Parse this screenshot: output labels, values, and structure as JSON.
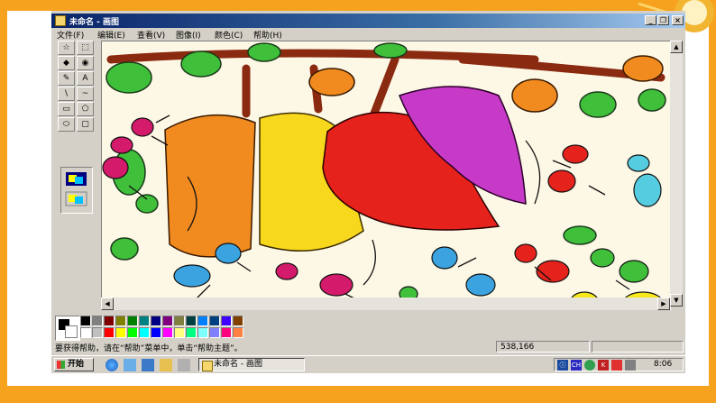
{
  "window": {
    "title": "未命名 - 画图"
  },
  "menu": [
    "文件(F)",
    "编辑(E)",
    "查看(V)",
    "图像(I)",
    "颜色(C)",
    "帮助(H)"
  ],
  "tools": [
    "☆",
    "⬚",
    "◆",
    "◉",
    "✎",
    "A",
    "\\",
    "~",
    "▭",
    "⬠",
    "⬭",
    "▢"
  ],
  "palette": [
    "#000000",
    "#808080",
    "#800000",
    "#808000",
    "#008000",
    "#008080",
    "#000080",
    "#800080",
    "#808040",
    "#004040",
    "#0080ff",
    "#004080",
    "#4000ff",
    "#804000",
    "#ffffff",
    "#c0c0c0",
    "#ff0000",
    "#ffff00",
    "#00ff00",
    "#00ffff",
    "#0000ff",
    "#ff00ff",
    "#ffff80",
    "#00ff80",
    "#80ffff",
    "#8080ff",
    "#ff0080",
    "#ff8040"
  ],
  "status": {
    "help": "要获得帮助，请在“帮助”菜单中，单击“帮助主题”。",
    "coords": "538,166"
  },
  "taskbar": {
    "start": "开始",
    "task": "未命名 - 画图",
    "clock": "8:06"
  }
}
